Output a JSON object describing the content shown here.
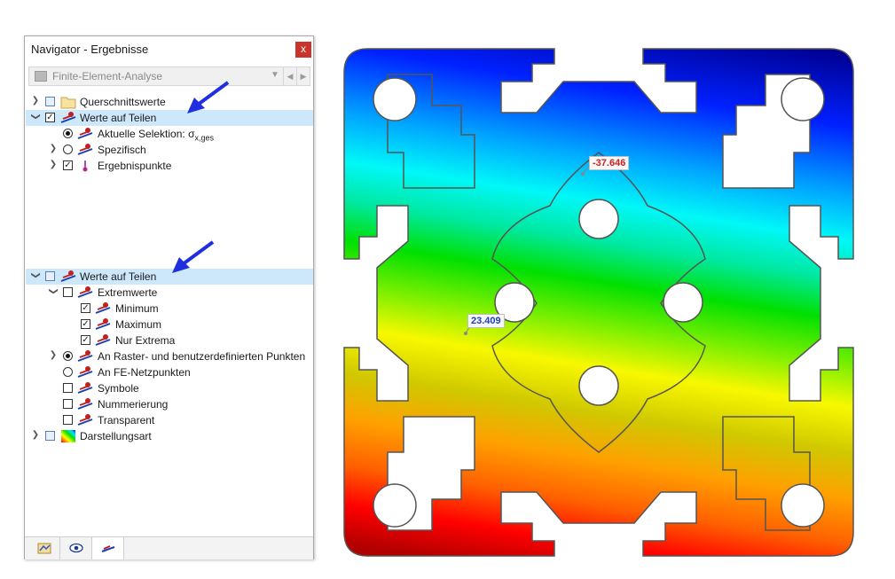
{
  "panel": {
    "title": "Navigator - Ergebnisse",
    "close_label": "x",
    "dropdown": {
      "value": "Finite-Element-Analyse"
    }
  },
  "tree1": {
    "querschnitt": "Querschnittswerte",
    "werte": "Werte auf Teilen",
    "aktuelle_prefix": "Aktuelle Selektion: ",
    "sigma": "σ",
    "sigma_sub": "x,ges",
    "spezifisch": "Spezifisch",
    "ergebnispunkte": "Ergebnispunkte"
  },
  "tree2": {
    "werte": "Werte auf Teilen",
    "extremwerte": "Extremwerte",
    "minimum": "Minimum",
    "maximum": "Maximum",
    "nur_extrema": "Nur Extrema",
    "raster": "An Raster- und benutzerdefinierten Punkten",
    "fe_netz": "An FE-Netzpunkten",
    "symbole": "Symbole",
    "nummerierung": "Nummerierung",
    "transparent": "Transparent",
    "darstellungsart": "Darstellungsart"
  },
  "plot": {
    "min_label": "-37.646",
    "max_label": "23.409"
  },
  "colors": {
    "highlight": "#cde8fb",
    "arrow": "#1f2fe0",
    "min_text": "#d02020",
    "max_text": "#2040c0"
  }
}
